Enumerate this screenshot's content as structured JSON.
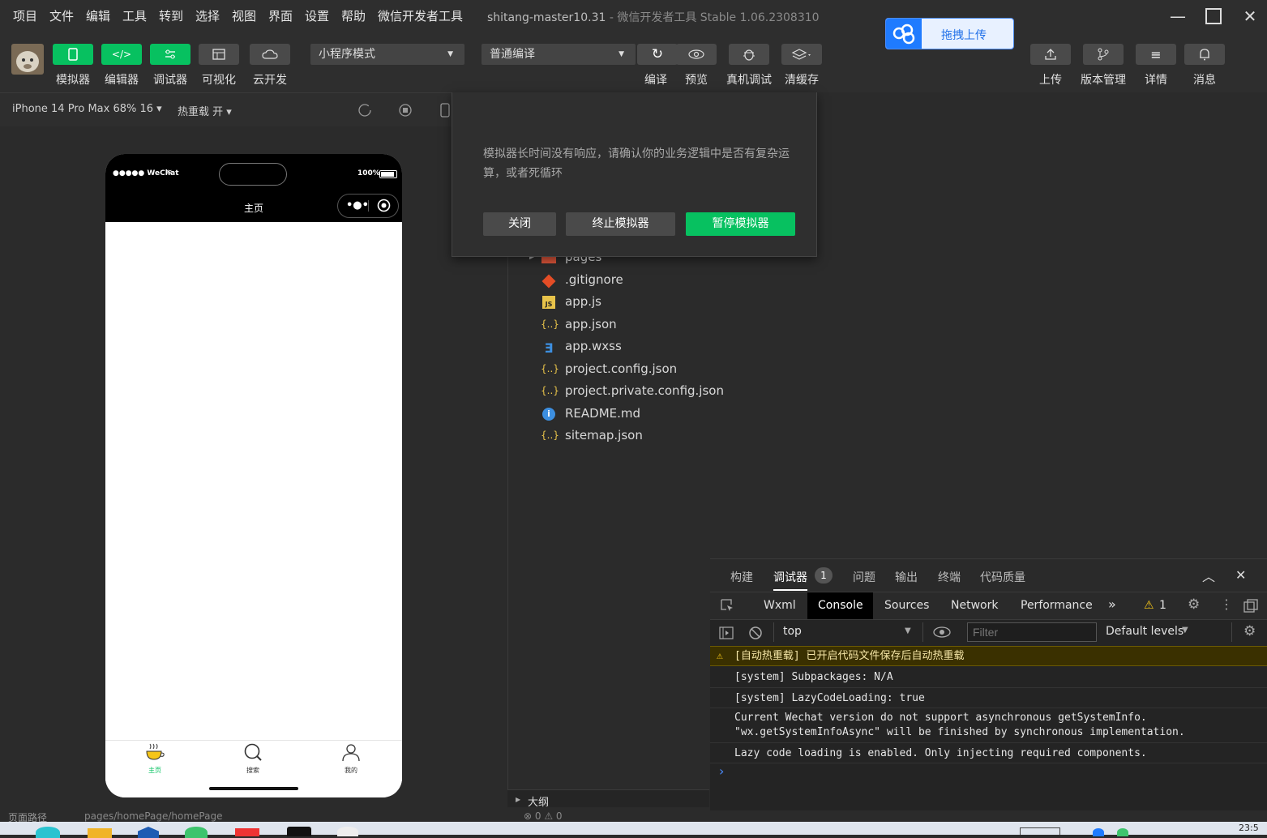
{
  "menu": {
    "items": [
      "项目",
      "文件",
      "编辑",
      "工具",
      "转到",
      "选择",
      "视图",
      "界面",
      "设置",
      "帮助",
      "微信开发者工具"
    ],
    "project_name": "shitang-master10.31",
    "app_title": "- 微信开发者工具 Stable 1.06.2308310"
  },
  "toolbar": {
    "simulator": "模拟器",
    "editor": "编辑器",
    "debugger": "调试器",
    "visual": "可视化",
    "cloud": "云开发",
    "mode_select": "小程序模式",
    "compile_select": "普通编译",
    "compile": "编译",
    "preview": "预览",
    "real_debug": "真机调试",
    "clear_cache": "清缓存",
    "upload": "上传",
    "version": "版本管理",
    "details": "详情",
    "messages": "消息"
  },
  "upload_widget": {
    "label": "拖拽上传"
  },
  "subbar": {
    "device": "iPhone 14 Pro Max 68% 16 ▾",
    "hot_reload": "热重载 开 ▾"
  },
  "phone": {
    "carrier": "●●●●● WeChat",
    "battery": "100%",
    "nav_title": "主页",
    "tabs": [
      {
        "label": "主页",
        "icon": "coffee-icon",
        "active": true
      },
      {
        "label": "搜索",
        "icon": "search-icon",
        "active": false
      },
      {
        "label": "我的",
        "icon": "user-icon",
        "active": false
      }
    ]
  },
  "dialog": {
    "message": "模拟器长时间没有响应，请确认你的业务逻辑中是否有复杂运算，或者死循环",
    "close": "关闭",
    "terminate": "终止模拟器",
    "pause": "暂停模拟器"
  },
  "explorer": {
    "files": [
      {
        "name": "pages",
        "icon": "folder-icon"
      },
      {
        "name": ".gitignore",
        "icon": "git-icon"
      },
      {
        "name": "app.js",
        "icon": "js-icon"
      },
      {
        "name": "app.json",
        "icon": "json-icon"
      },
      {
        "name": "app.wxss",
        "icon": "css-icon"
      },
      {
        "name": "project.config.json",
        "icon": "json-icon"
      },
      {
        "name": "project.private.config.json",
        "icon": "json-icon"
      },
      {
        "name": "README.md",
        "icon": "info-icon"
      },
      {
        "name": "sitemap.json",
        "icon": "json-icon"
      }
    ],
    "outline": "大纲"
  },
  "devtools": {
    "top_tabs": [
      "构建",
      "调试器",
      "问题",
      "输出",
      "终端",
      "代码质量"
    ],
    "debugger_badge": "1",
    "panel_tabs": [
      "Wxml",
      "Console",
      "Sources",
      "Network",
      "Performance"
    ],
    "warning_count": "1",
    "context": "top",
    "filter_placeholder": "Filter",
    "levels": "Default levels",
    "logs": [
      {
        "level": "warning",
        "text": "[自动热重载] 已开启代码文件保存后自动热重载"
      },
      {
        "level": "info",
        "text": "[system] Subpackages: N/A"
      },
      {
        "level": "info",
        "text": "[system] LazyCodeLoading: true"
      },
      {
        "level": "info",
        "text": "Current Wechat version do not support asynchronous getSystemInfo.\n\"wx.getSystemInfoAsync\" will be finished by synchronous implementation."
      },
      {
        "level": "info",
        "text": "Lazy code loading is enabled. Only injecting required components."
      }
    ],
    "prompt": "›"
  },
  "statusbar": {
    "label": "页面路径",
    "path": "pages/homePage/homePage",
    "problems": "⊗ 0 ⚠ 0"
  },
  "taskbar": {
    "clock": "23:5"
  }
}
